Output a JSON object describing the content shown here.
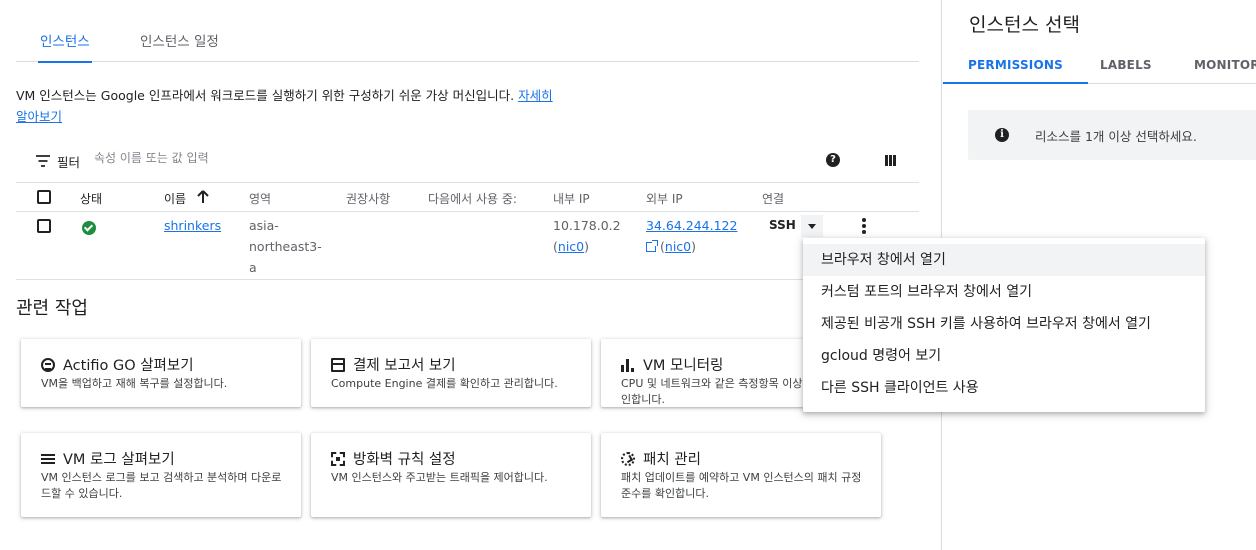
{
  "tabs": {
    "instances": "인스턴스",
    "schedules": "인스턴스 일정"
  },
  "description": {
    "text": "VM 인스턴스는 Google 인프라에서 워크로드를 실행하기 위한 구성하기 쉬운 가상 머신입니다. ",
    "link": "자세히 알아보기"
  },
  "filter": {
    "label": "필터",
    "placeholder": "속성 이름 또는 값 입력"
  },
  "table": {
    "headers": {
      "status": "상태",
      "name": "이름",
      "zone": "영역",
      "recommendations": "권장사항",
      "in_use_by": "다음에서 사용 중:",
      "internal_ip": "내부 IP",
      "external_ip": "외부 IP",
      "connect": "연결"
    },
    "rows": [
      {
        "status": "running",
        "name": "shrinkers",
        "zone_line1": "asia-",
        "zone_line2": "northeast3-",
        "zone_line3": "a",
        "internal_ip": "10.178.0.2",
        "internal_nic": "nic0",
        "external_ip": "34.64.244.122",
        "external_nic": "nic0",
        "connect": "SSH"
      }
    ]
  },
  "ssh_menu": {
    "items": [
      "브라우저 창에서 열기",
      "커스텀 포트의 브라우저 창에서 열기",
      "제공된 비공개 SSH 키를 사용하여 브라우저 창에서 열기",
      "gcloud 명령어 보기",
      "다른 SSH 클라이언트 사용"
    ]
  },
  "related": {
    "title": "관련 작업",
    "cards": [
      {
        "title": "Actifio GO 살펴보기",
        "desc": "VM을 백업하고 재해 복구를 설정합니다."
      },
      {
        "title": "결제 보고서 보기",
        "desc": "Compute Engine 결제를 확인하고 관리합니다."
      },
      {
        "title": "VM 모니터링",
        "desc": "CPU 및 네트워크와 같은 측정항목 이상점 VM을 확인합니다."
      },
      {
        "title": "VM 로그 살펴보기",
        "desc": "VM 인스턴스 로그를 보고 검색하고 분석하며 다운로드할 수 있습니다."
      },
      {
        "title": "방화벽 규칙 설정",
        "desc": "VM 인스턴스와 주고받는 트래픽을 제어합니다."
      },
      {
        "title": "패치 관리",
        "desc": "패치 업데이트를 예약하고 VM 인스턴스의 패치 규정 준수를 확인합니다."
      }
    ]
  },
  "side_panel": {
    "title": "인스턴스 선택",
    "tabs": [
      "PERMISSIONS",
      "LABELS",
      "MONITORI"
    ],
    "info": "리소스를 1개 이상 선택하세요."
  },
  "colors": {
    "accent": "#1a73e8",
    "status_ok": "#1e8e3e"
  }
}
